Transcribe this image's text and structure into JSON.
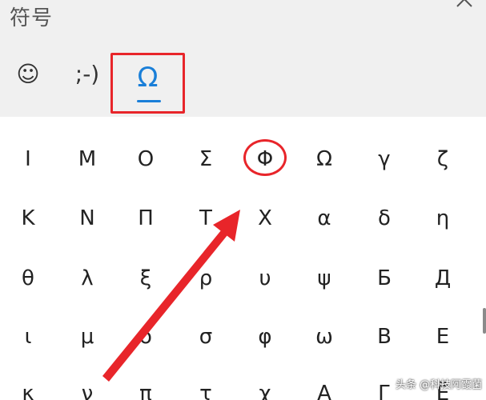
{
  "panel": {
    "title": "符号"
  },
  "tabs": [
    {
      "name": "emoji",
      "label": "☺",
      "selected": false
    },
    {
      "name": "kaomoji",
      "label": ";-)",
      "selected": false
    },
    {
      "name": "symbols",
      "label": "Ω",
      "selected": true
    }
  ],
  "symbol_grid": {
    "rows": [
      [
        "Ι",
        "Μ",
        "Ο",
        "Σ",
        "Φ",
        "Ω",
        "γ",
        "ζ"
      ],
      [
        "Κ",
        "Ν",
        "Π",
        "Τ",
        "Χ",
        "α",
        "δ",
        "η"
      ],
      [
        "θ",
        "λ",
        "ξ",
        "ρ",
        "υ",
        "ψ",
        "Б",
        "Д"
      ],
      [
        "ι",
        "μ",
        "ο",
        "σ",
        "φ",
        "ω",
        "В",
        "Е"
      ],
      [
        "κ",
        "ν",
        "π",
        "τ",
        "χ",
        "А",
        "Г",
        "Ё"
      ]
    ],
    "highlighted_symbol": "Φ"
  },
  "annotation": {
    "color": "#e8252a"
  },
  "colors": {
    "accent": "#1a7fd8",
    "annotation_red": "#e8252a",
    "header_bg": "#f0f0f0"
  },
  "watermark": {
    "text": "头条 @科技阿霞菌"
  }
}
